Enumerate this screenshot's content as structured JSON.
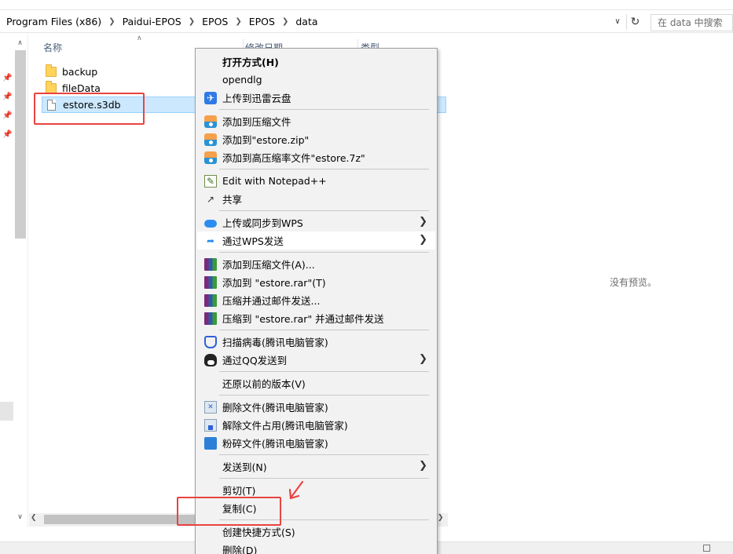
{
  "breadcrumb": [
    "Program Files (x86)",
    "Paidui-EPOS",
    "EPOS",
    "EPOS",
    "data"
  ],
  "search": {
    "placeholder": "在 data 中搜索"
  },
  "columns": {
    "name": "名称",
    "date": "修改日期",
    "type": "类型"
  },
  "files": [
    {
      "name": "backup",
      "kind": "folder"
    },
    {
      "name": "fileData",
      "kind": "folder"
    },
    {
      "name": "estore.s3db",
      "kind": "file",
      "selected": true
    }
  ],
  "preview": {
    "empty_text": "没有预览。"
  },
  "context_menu": {
    "items": [
      {
        "label": "打开方式(H)",
        "bold": true,
        "icon": "none"
      },
      {
        "label": "opendlg",
        "icon": "none"
      },
      {
        "label": "上传到迅雷云盘",
        "icon": "xunlei-icon"
      },
      {
        "label": "添加到压缩文件",
        "icon": "zip-icon"
      },
      {
        "label": "添加到\"estore.zip\"",
        "icon": "zip-icon"
      },
      {
        "label": "添加到高压缩率文件\"estore.7z\"",
        "icon": "zip-icon"
      },
      {
        "label": "Edit with Notepad++",
        "icon": "notepad-icon"
      },
      {
        "label": "共享",
        "icon": "share-icon"
      },
      {
        "label": "上传或同步到WPS",
        "icon": "wps-cloud-icon",
        "submenu": true
      },
      {
        "label": "通过WPS发送",
        "icon": "wps-send-icon",
        "submenu": true,
        "hover": true
      },
      {
        "label": "添加到压缩文件(A)...",
        "icon": "winrar-icon"
      },
      {
        "label": "添加到 \"estore.rar\"(T)",
        "icon": "winrar-icon"
      },
      {
        "label": "压缩并通过邮件发送...",
        "icon": "winrar-icon"
      },
      {
        "label": "压缩到 \"estore.rar\" 并通过邮件发送",
        "icon": "winrar-icon"
      },
      {
        "label": "扫描病毒(腾讯电脑管家)",
        "icon": "tencent-shield-icon"
      },
      {
        "label": "通过QQ发送到",
        "icon": "qq-icon",
        "submenu": true
      },
      {
        "label": "还原以前的版本(V)",
        "icon": "none"
      },
      {
        "label": "删除文件(腾讯电脑管家)",
        "icon": "tencent-delete-icon"
      },
      {
        "label": "解除文件占用(腾讯电脑管家)",
        "icon": "tencent-unlock-icon"
      },
      {
        "label": "粉碎文件(腾讯电脑管家)",
        "icon": "tencent-shred-icon"
      },
      {
        "label": "发送到(N)",
        "icon": "none",
        "submenu": true
      },
      {
        "label": "剪切(T)",
        "icon": "none"
      },
      {
        "label": "复制(C)",
        "icon": "none",
        "highlighted": true
      },
      {
        "label": "创建快捷方式(S)",
        "icon": "none"
      },
      {
        "label": "删除(D)",
        "icon": "none"
      }
    ]
  },
  "colors": {
    "selection": "#cce8ff",
    "annotation_red": "#e94340",
    "menu_bg": "#f2f2f2"
  }
}
